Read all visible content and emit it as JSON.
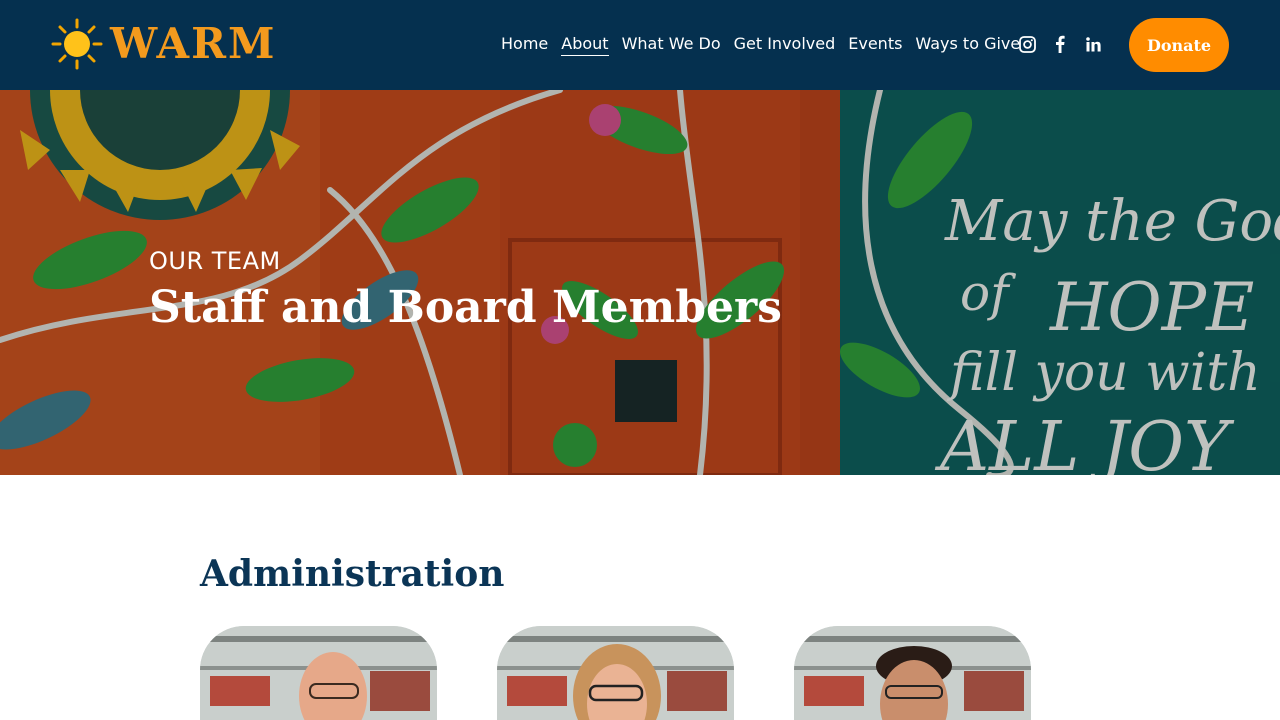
{
  "header": {
    "logo_text": "WARM",
    "nav": [
      {
        "label": "Home",
        "active": false
      },
      {
        "label": "About",
        "active": true
      },
      {
        "label": "What We Do",
        "active": false
      },
      {
        "label": "Get Involved",
        "active": false
      },
      {
        "label": "Events",
        "active": false
      },
      {
        "label": "Ways to Give",
        "active": false
      }
    ],
    "social_icons": [
      "instagram-icon",
      "facebook-icon",
      "linkedin-icon"
    ],
    "donate_label": "Donate"
  },
  "hero": {
    "eyebrow": "OUR TEAM",
    "title": "Staff and Board Members",
    "mural_text": [
      "May the God",
      "of HOPE",
      "fill you with",
      "ALL JOY"
    ]
  },
  "section": {
    "title": "Administration",
    "members": [
      {
        "photo": "staff-photo-1"
      },
      {
        "photo": "staff-photo-2"
      },
      {
        "photo": "staff-photo-3"
      }
    ]
  },
  "colors": {
    "header_bg": "#05304f",
    "brand_orange": "#f39a1e",
    "donate_bg": "#ff8c00",
    "heading_navy": "#0b3556"
  }
}
